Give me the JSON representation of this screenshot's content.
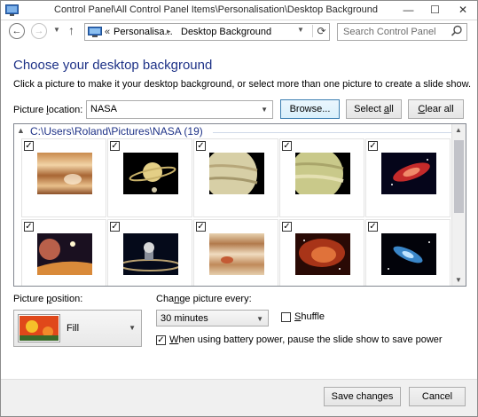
{
  "window": {
    "title": "Control Panel\\All Control Panel Items\\Personalisation\\Desktop Background",
    "minimize": "—",
    "maximize": "☐",
    "close": "✕"
  },
  "nav": {
    "back": "←",
    "forward": "→",
    "history_dropdown": "▼",
    "up": "↑",
    "chevrons": "«",
    "crumbs": [
      "Personalisa...",
      "Desktop Background"
    ],
    "crumb_separator": "▸",
    "address_dropdown": "▼",
    "refresh": "⟳",
    "search_placeholder": "Search Control Panel"
  },
  "main": {
    "heading": "Choose your desktop background",
    "description": "Click a picture to make it your desktop background, or select more than one picture to create a slide show.",
    "picture_location_label_pre": "Picture ",
    "picture_location_label_key": "l",
    "picture_location_label_post": "ocation:",
    "picture_location_value": "NASA",
    "browse": "Browse...",
    "select_all_pre": "Select ",
    "select_all_key": "a",
    "select_all_post": "ll",
    "clear_all_key": "C",
    "clear_all_post": "lear all"
  },
  "gallery": {
    "group_chevron": "▲",
    "group_title": "C:\\Users\\Roland\\Pictures\\NASA (19)",
    "scroll_up": "▲",
    "scroll_down": "▼",
    "check_mark": "✓",
    "items": [
      {
        "icon": "gas-giant-bands",
        "checked": true
      },
      {
        "icon": "saturn-rings",
        "checked": true
      },
      {
        "icon": "jupiter-crescent",
        "checked": true
      },
      {
        "icon": "jupiter-green",
        "checked": true
      },
      {
        "icon": "red-nebula",
        "checked": true
      },
      {
        "icon": "planet-horizon",
        "checked": true
      },
      {
        "icon": "cassini-probe",
        "checked": true
      },
      {
        "icon": "jupiter-closeup",
        "checked": true
      },
      {
        "icon": "orange-nebula",
        "checked": true
      },
      {
        "icon": "blue-galaxy",
        "checked": true
      }
    ]
  },
  "options": {
    "position_label_pre": "Picture ",
    "position_label_key": "p",
    "position_label_post": "osition:",
    "position_value": "Fill",
    "change_label_pre": "Cha",
    "change_label_key": "n",
    "change_label_post": "ge picture every:",
    "change_value": "30 minutes",
    "dropdown_arrow": "▼",
    "shuffle_key": "S",
    "shuffle_post": "huffle",
    "shuffle_checked": false,
    "battery_key": "W",
    "battery_post": "hen using battery power, pause the slide show to save power",
    "battery_checked": true
  },
  "footer": {
    "save": "Save changes",
    "cancel": "Cancel"
  },
  "colors": {
    "heading": "#1e3287",
    "accent_border": "#3c7fb1"
  }
}
